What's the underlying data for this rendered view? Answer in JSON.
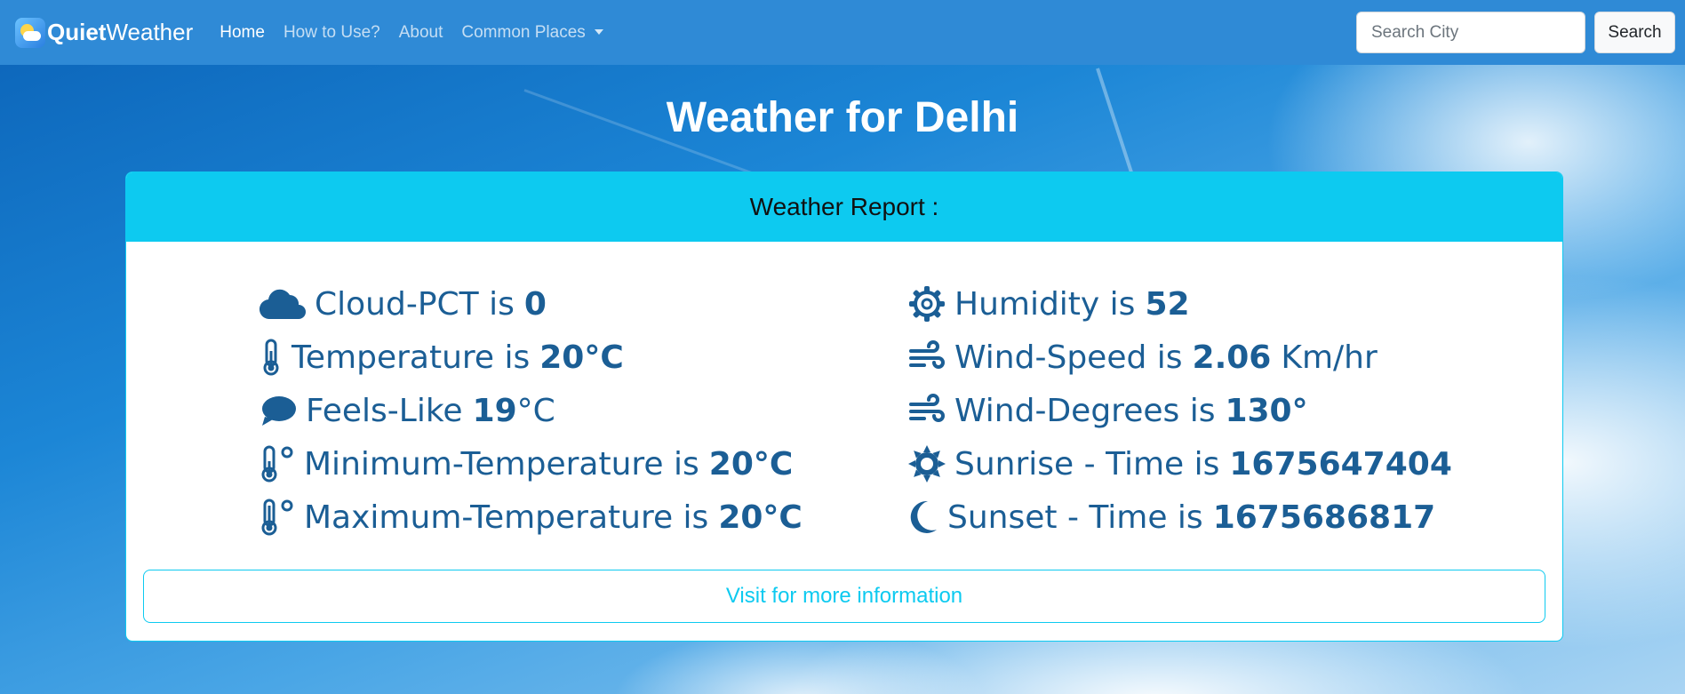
{
  "brand": {
    "bold": "Quiet",
    "regular": "Weather"
  },
  "nav": {
    "home": "Home",
    "how_to_use": "How to Use?",
    "about": "About",
    "common_places": "Common Places"
  },
  "search": {
    "placeholder": "Search City",
    "button": "Search"
  },
  "page_title": "Weather for Delhi",
  "card": {
    "header": "Weather Report :",
    "left": [
      {
        "label": "Cloud-PCT is",
        "value": "0",
        "unit": "",
        "icon": "cloud-icon"
      },
      {
        "label": "Temperature is",
        "value": "20°C",
        "unit": "",
        "icon": "thermometer-icon"
      },
      {
        "label": "Feels-Like",
        "value": "19",
        "unit": "°C",
        "icon": "chat-icon"
      },
      {
        "label": "Minimum-Temperature is",
        "value": "20°C",
        "unit": "",
        "icon": "thermometer-low-icon"
      },
      {
        "label": "Maximum-Temperature is",
        "value": "20°C",
        "unit": "",
        "icon": "thermometer-high-icon"
      }
    ],
    "right": [
      {
        "label": "Humidity is",
        "value": "52",
        "unit": "",
        "icon": "gear-icon"
      },
      {
        "label": "Wind-Speed is",
        "value": "2.06",
        "unit": "Km/hr",
        "icon": "wind-icon"
      },
      {
        "label": "Wind-Degrees is",
        "value": "130°",
        "unit": "",
        "icon": "wind-icon"
      },
      {
        "label": "Sunrise - Time is",
        "value": "1675647404",
        "unit": "",
        "icon": "sun-icon"
      },
      {
        "label": "Sunset - Time is",
        "value": "1675686817",
        "unit": "",
        "icon": "moon-icon"
      }
    ],
    "more_button": "Visit for more information"
  },
  "colors": {
    "navbar": "#2f8ad6",
    "accent": "#0dcaf0",
    "metric_text": "#1b5e95"
  }
}
